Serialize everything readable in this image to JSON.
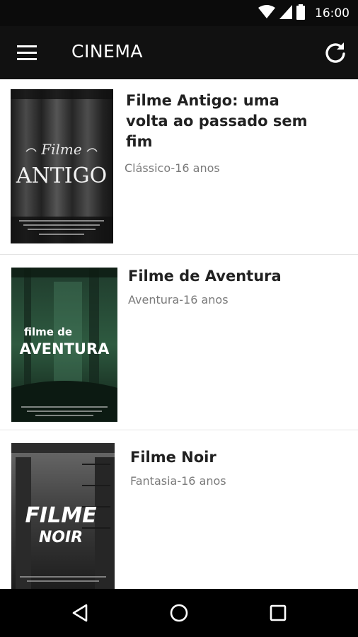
{
  "status_bar": {
    "time": "16:00",
    "icons": [
      "wifi-icon",
      "signal-icon",
      "battery-icon"
    ]
  },
  "app_bar": {
    "title": "CINEMA",
    "menu_icon": "hamburger-menu-icon",
    "refresh_icon": "refresh-icon"
  },
  "movies": [
    {
      "title": "Filme Antigo: uma volta ao passado sem fim",
      "title_lines": [
        "Filme Antigo: uma",
        "volta ao passado sem",
        "fim"
      ],
      "subtitle": "Clássico-16 anos",
      "poster_text": [
        "Filme",
        "ANTIGO"
      ]
    },
    {
      "title": "Filme de Aventura",
      "subtitle": "Aventura-16 anos",
      "poster_text": [
        "filme de",
        "AVENTURA"
      ]
    },
    {
      "title": "Filme Noir",
      "subtitle": "Fantasia-16 anos",
      "poster_text": [
        "FILME",
        "NOIR"
      ]
    }
  ],
  "nav_bar": {
    "icons": [
      "back-icon",
      "home-icon",
      "recents-icon"
    ]
  },
  "colors": {
    "status_bar": "#0b0b0b",
    "app_bar": "#111111",
    "nav_bar": "#000000",
    "title_text": "#212121",
    "subtitle_text": "#7a7a7a"
  }
}
